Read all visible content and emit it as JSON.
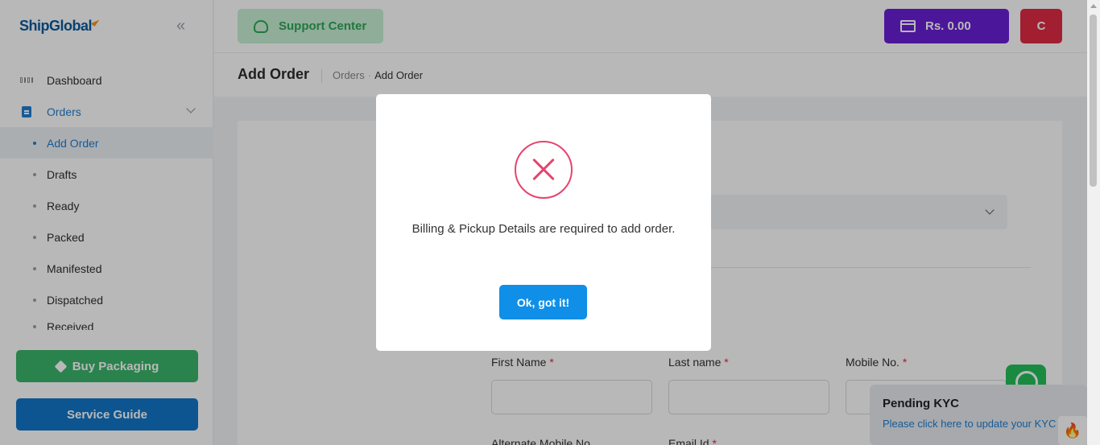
{
  "brand": {
    "name": "ShipGlobal"
  },
  "sidebar": {
    "collapse_glyph": "«",
    "items": [
      {
        "label": "Dashboard",
        "icon": "dashboard-grid-icon"
      },
      {
        "label": "Orders",
        "icon": "orders-icon"
      }
    ],
    "sub_items": [
      {
        "label": "Add Order"
      },
      {
        "label": "Drafts"
      },
      {
        "label": "Ready"
      },
      {
        "label": "Packed"
      },
      {
        "label": "Manifested"
      },
      {
        "label": "Dispatched"
      },
      {
        "label": "Received"
      }
    ],
    "buy_packaging_label": "Buy Packaging",
    "service_guide_label": "Service Guide"
  },
  "header": {
    "support_label": "Support Center",
    "wallet_label": "Rs. 0.00",
    "avatar_initial": "C"
  },
  "page": {
    "title": "Add Order",
    "breadcrumb": [
      "Orders",
      "Add Order"
    ]
  },
  "form": {
    "first_name_label": "First Name",
    "last_name_label": "Last name",
    "mobile_label": "Mobile No.",
    "alt_mobile_label": "Alternate Mobile No.",
    "email_label": "Email Id",
    "required_mark": "*"
  },
  "kyc": {
    "title": "Pending KYC",
    "link": "Please click here to update your KYC"
  },
  "modal": {
    "message": "Billing & Pickup Details are required to add order.",
    "ok_label": "Ok, got it!"
  },
  "colors": {
    "accent_blue": "#1f7fd0",
    "wallet_purple": "#6a1fd6",
    "avatar_red": "#e02b44",
    "error_pink": "#e6446d",
    "ok_blue": "#0f8fe8"
  }
}
